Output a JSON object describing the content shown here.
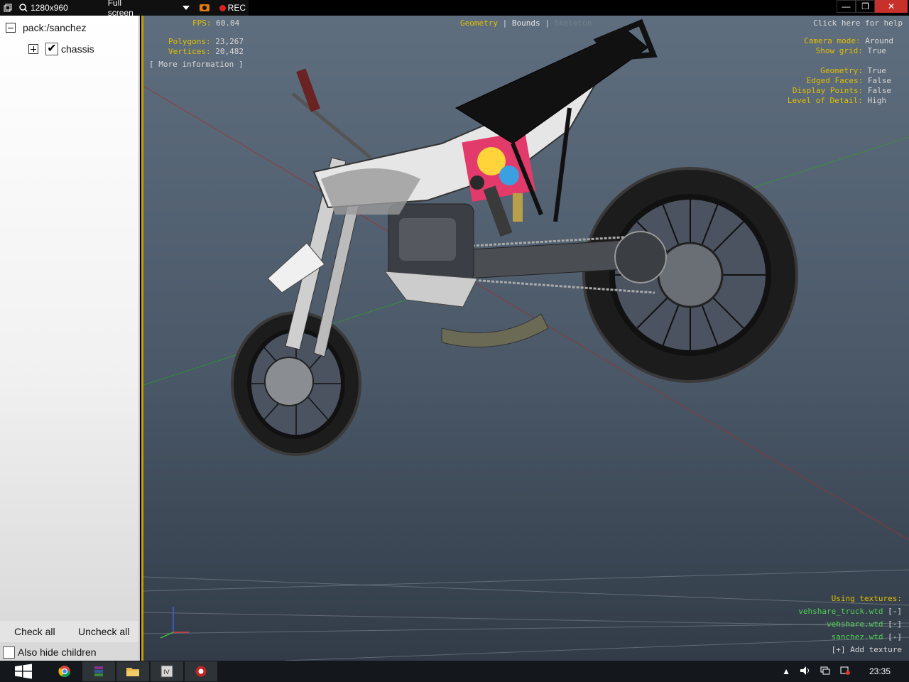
{
  "recorder": {
    "resolution": "1280x960",
    "mode": "Full screen",
    "rec_label": "REC"
  },
  "window_controls": {
    "minimize": "—",
    "restore": "❐",
    "close": "✕"
  },
  "left_panel": {
    "root_label": "pack:/sanchez",
    "child_label": "chassis",
    "check_all": "Check all",
    "uncheck_all": "Uncheck all",
    "hide_children": "Also hide children"
  },
  "hud": {
    "fps_label": "FPS:",
    "fps_value": "60.04",
    "polygons_label": "Polygons:",
    "polygons_value": "23,267",
    "vertices_label": "Vertices:",
    "vertices_value": "20,482",
    "more_info": "[ More information ]",
    "tabs": {
      "geometry": "Geometry",
      "sep1": "|",
      "bounds": "Bounds",
      "sep2": "|",
      "skeleton": "Skeleton"
    },
    "help": "Click here for help",
    "camera_mode_label": "Camera mode:",
    "camera_mode_value": "Around",
    "show_grid_label": "Show grid:",
    "show_grid_value": "True",
    "geometry_label": "Geometry:",
    "geometry_value": "True",
    "edged_faces_label": "Edged Faces:",
    "edged_faces_value": "False",
    "display_points_label": "Display Points:",
    "display_points_value": "False",
    "lod_label": "Level of Detail:",
    "lod_value": "High",
    "using_textures": "Using textures:",
    "textures": [
      {
        "name": "vehshare_truck.wtd",
        "action": "[-]"
      },
      {
        "name": "vehshare.wtd",
        "action": "[-]"
      },
      {
        "name": "sanchez.wtd",
        "action": "[-]"
      }
    ],
    "add_texture": "[+] Add texture"
  },
  "taskbar": {
    "clock": "23:35"
  },
  "colors": {
    "hud_yellow": "#e0c000",
    "hud_value": "#d8d8d8",
    "texture_green": "#4fd050",
    "viewport_border": "#c8a000"
  }
}
